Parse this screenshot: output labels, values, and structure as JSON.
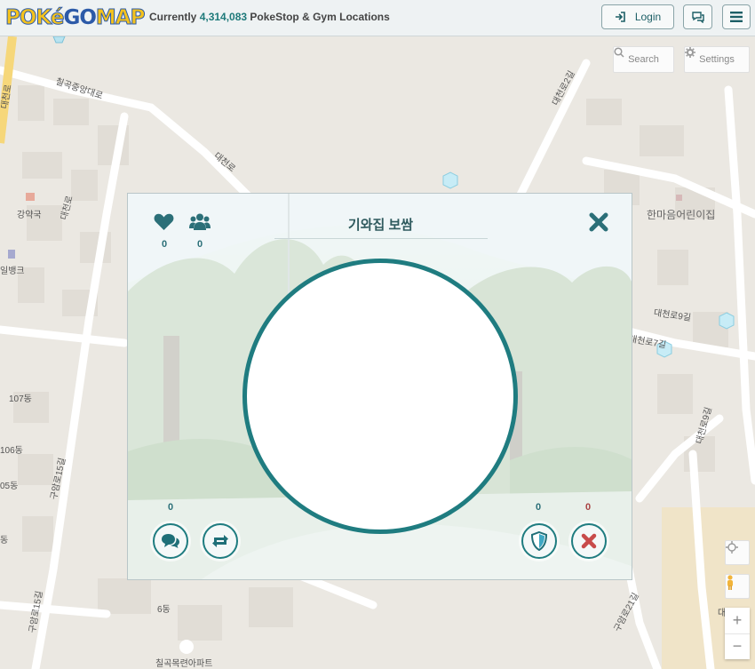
{
  "header": {
    "logo": "POKE GO MAP",
    "tagline_prefix": "Currently",
    "location_count": "4,314,083",
    "tagline_suffix": "PokeStop & Gym Locations",
    "login_label": "Login",
    "chat_icon": "chat-icon",
    "menu_icon": "menu-icon"
  },
  "map_controls": {
    "search_label": "Search",
    "settings_label": "Settings",
    "zoom_in": "+",
    "zoom_out": "−"
  },
  "map_labels": {
    "road1": "칠곡중앙대로",
    "road2": "대천로",
    "road3": "대천로",
    "road4": "대천로2길",
    "road5": "대천로9길",
    "road6": "대천로7길",
    "road7": "대천로9길",
    "road8": "구암로15길",
    "road9": "구암로15길",
    "road10": "구암로21길",
    "road11": "대천로",
    "poi1": "한마음어린이집",
    "poi2": "강약국",
    "poi3": "일뱅크",
    "poi4": "칠곡목련아파트",
    "bldg1": "107동",
    "bldg2": "106동",
    "bldg3": "05동",
    "bldg4": "동",
    "bldg5": "6동",
    "corner": "대천로"
  },
  "dialog": {
    "title": "기와집 보쌈",
    "likes": "0",
    "visitors": "0",
    "comments": "0",
    "gym_count": "0",
    "report_count": "0",
    "icons": [
      "heart-icon",
      "users-icon",
      "close-icon",
      "comment-icon",
      "share-icon",
      "shield-icon",
      "x-icon"
    ]
  },
  "colors": {
    "accent": "#1f7c80",
    "title": "#2f5a5e",
    "report": "#c84b4b"
  }
}
